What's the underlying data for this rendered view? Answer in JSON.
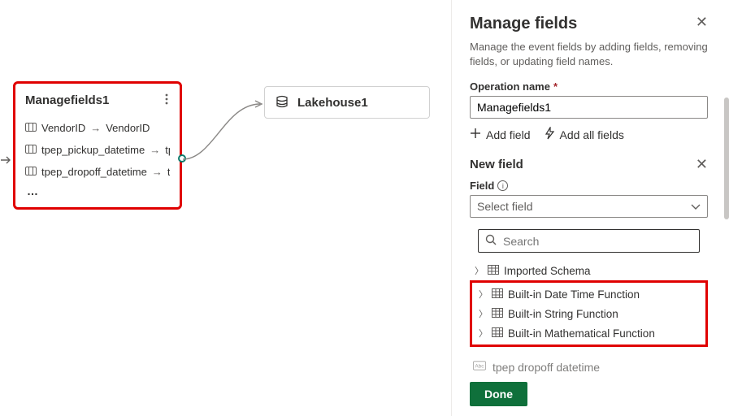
{
  "canvas": {
    "node1": {
      "title": "Managefields1",
      "rows": [
        {
          "from": "VendorID",
          "to": "VendorID"
        },
        {
          "from": "tpep_pickup_datetime",
          "to": "tpe"
        },
        {
          "from": "tpep_dropoff_datetime",
          "to": "tp"
        }
      ],
      "ellipsis": "…"
    },
    "node2": {
      "title": "Lakehouse1"
    }
  },
  "panel": {
    "title": "Manage fields",
    "description": "Manage the event fields by adding fields, removing fields, or updating field names.",
    "operation_name_label": "Operation name",
    "operation_name_value": "Managefields1",
    "add_field_label": "Add field",
    "add_all_label": "Add all fields",
    "new_field_label": "New field",
    "field_label": "Field",
    "select_placeholder": "Select field",
    "search_placeholder": "Search",
    "tree": {
      "imported": "Imported Schema",
      "datetime": "Built-in Date Time Function",
      "string": "Built-in String Function",
      "math": "Built-in Mathematical Function"
    },
    "bottom_field": "tpep dropoff datetime",
    "done_label": "Done"
  }
}
